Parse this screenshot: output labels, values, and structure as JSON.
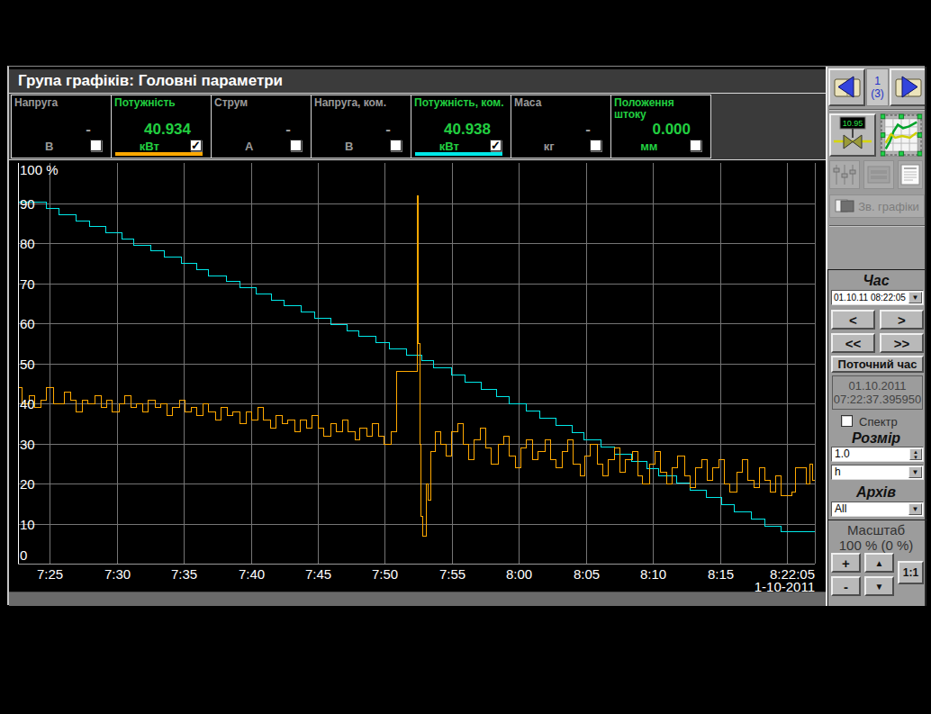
{
  "window": {
    "title": "Група графіків: Головні параметри"
  },
  "params": [
    {
      "name": "Напруга",
      "value": "-",
      "unit": "В",
      "checked": false,
      "active": false,
      "underline": ""
    },
    {
      "name": "Потужність",
      "value": "40.934",
      "unit": "кВт",
      "checked": true,
      "active": true,
      "underline": "#ffa800"
    },
    {
      "name": "Струм",
      "value": "-",
      "unit": "А",
      "checked": false,
      "active": false,
      "underline": ""
    },
    {
      "name": "Напруга, ком.",
      "value": "-",
      "unit": "В",
      "checked": false,
      "active": false,
      "underline": ""
    },
    {
      "name": "Потужність, ком.",
      "value": "40.938",
      "unit": "кВт",
      "checked": true,
      "active": true,
      "underline": "#00e8e8"
    },
    {
      "name": "Маса",
      "value": "-",
      "unit": "кг",
      "checked": false,
      "active": false,
      "underline": ""
    },
    {
      "name": "Положення штоку",
      "value": "0.000",
      "unit": "мм",
      "checked": false,
      "active": true,
      "underline": ""
    }
  ],
  "sidebar": {
    "page_current": "1",
    "page_total": "(3)",
    "valve_display": "10.95",
    "group_button_label": "Зв. графіки",
    "time": {
      "title": "Час",
      "combo_value": "01.10.11 08:22:05",
      "btn_prev": "<",
      "btn_next": ">",
      "btn_prev_fast": "<<",
      "btn_next_fast": ">>",
      "current_time_btn": "Поточний час",
      "info_date": "01.10.2011",
      "info_time": "07:22:37.395950",
      "spectrum_label": "Спектр"
    },
    "size": {
      "title": "Розмір",
      "value": "1.0",
      "unit_value": "h"
    },
    "archive": {
      "title": "Архів",
      "value": "All"
    },
    "scale": {
      "title": "Масштаб",
      "value": "100 % (0 %)",
      "plus": "+",
      "minus": "-",
      "one_to_one": "1:1"
    }
  },
  "chart_data": {
    "type": "line",
    "ylim": [
      0,
      100
    ],
    "xlim_minutes": [
      0,
      59.47
    ],
    "y_top_label": "100 %",
    "y_zero_label": "0",
    "y_ticks": [
      10,
      20,
      30,
      40,
      50,
      60,
      70,
      80,
      90
    ],
    "x_ticks": [
      {
        "t": 2.383,
        "label": "7:25"
      },
      {
        "t": 7.383,
        "label": "7:30"
      },
      {
        "t": 12.383,
        "label": "7:35"
      },
      {
        "t": 17.383,
        "label": "7:40"
      },
      {
        "t": 22.383,
        "label": "7:45"
      },
      {
        "t": 27.383,
        "label": "7:50"
      },
      {
        "t": 32.383,
        "label": "7:55"
      },
      {
        "t": 37.383,
        "label": "8:00"
      },
      {
        "t": 42.383,
        "label": "8:05"
      },
      {
        "t": 47.383,
        "label": "8:10"
      },
      {
        "t": 52.383,
        "label": "8:15"
      },
      {
        "t": 57.383,
        "label": ""
      }
    ],
    "x_end_label": "8:22:05",
    "date_label": "1-10-2011",
    "grid_color": "#757575",
    "series": [
      {
        "name": "Потужність, ком.",
        "color": "#00e8e8",
        "points": [
          [
            0,
            90.3
          ],
          [
            2.1,
            88.8
          ],
          [
            3.0,
            87.3
          ],
          [
            4.3,
            85.7
          ],
          [
            5.3,
            84.2
          ],
          [
            6.55,
            82.7
          ],
          [
            7.7,
            81.2
          ],
          [
            8.6,
            79.6
          ],
          [
            9.9,
            78.1
          ],
          [
            10.9,
            76.6
          ],
          [
            12.15,
            75.1
          ],
          [
            13.3,
            73.5
          ],
          [
            14.2,
            72
          ],
          [
            15.5,
            70.5
          ],
          [
            16.5,
            69
          ],
          [
            17.75,
            67.4
          ],
          [
            18.9,
            65.9
          ],
          [
            19.8,
            64.4
          ],
          [
            21.1,
            62.9
          ],
          [
            22.1,
            61.3
          ],
          [
            23.35,
            59.8
          ],
          [
            24.5,
            58.3
          ],
          [
            25.4,
            56.8
          ],
          [
            26.7,
            55.2
          ],
          [
            27.7,
            53.7
          ],
          [
            28.95,
            52.2
          ],
          [
            30.1,
            50.7
          ],
          [
            31.0,
            48.9
          ],
          [
            32.3,
            47.1
          ],
          [
            33.3,
            45.3
          ],
          [
            34.55,
            43.5
          ],
          [
            35.7,
            41.7
          ],
          [
            36.6,
            39.9
          ],
          [
            37.9,
            38.1
          ],
          [
            38.9,
            36.3
          ],
          [
            40.15,
            34.5
          ],
          [
            41.3,
            32.7
          ],
          [
            42.2,
            31
          ],
          [
            43.5,
            29.2
          ],
          [
            44.5,
            27.4
          ],
          [
            45.75,
            25.6
          ],
          [
            46.9,
            23.8
          ],
          [
            47.8,
            22
          ],
          [
            49.1,
            20.2
          ],
          [
            50.1,
            18.4
          ],
          [
            51.35,
            16.6
          ],
          [
            52.5,
            14.8
          ],
          [
            53.4,
            13
          ],
          [
            54.7,
            11.2
          ],
          [
            55.7,
            9.5
          ],
          [
            56.95,
            8
          ]
        ]
      },
      {
        "name": "Потужність",
        "color": "#ffa800",
        "points": [
          [
            0,
            44
          ],
          [
            0.3,
            40
          ],
          [
            0.8,
            42
          ],
          [
            1.2,
            39
          ],
          [
            1.7,
            41
          ],
          [
            2.1,
            44
          ],
          [
            2.6,
            40
          ],
          [
            3.0,
            40
          ],
          [
            3.4,
            43
          ],
          [
            3.9,
            41
          ],
          [
            4.3,
            38
          ],
          [
            4.8,
            41
          ],
          [
            5.2,
            40
          ],
          [
            5.7,
            42
          ],
          [
            6.2,
            39
          ],
          [
            6.6,
            41
          ],
          [
            7.0,
            38
          ],
          [
            7.5,
            40
          ],
          [
            7.9,
            42
          ],
          [
            8.4,
            39
          ],
          [
            8.8,
            40
          ],
          [
            9.3,
            38
          ],
          [
            9.7,
            41
          ],
          [
            10.2,
            39
          ],
          [
            10.6,
            40
          ],
          [
            11.1,
            37
          ],
          [
            11.5,
            39
          ],
          [
            12.0,
            41
          ],
          [
            12.4,
            38
          ],
          [
            12.9,
            39
          ],
          [
            13.3,
            37
          ],
          [
            13.8,
            40
          ],
          [
            14.2,
            38
          ],
          [
            14.7,
            36
          ],
          [
            15.1,
            39
          ],
          [
            15.6,
            37
          ],
          [
            16.0,
            38
          ],
          [
            16.5,
            35
          ],
          [
            17.0,
            38
          ],
          [
            17.4,
            36
          ],
          [
            17.9,
            39
          ],
          [
            18.3,
            36
          ],
          [
            18.8,
            34
          ],
          [
            19.2,
            37
          ],
          [
            19.7,
            35
          ],
          [
            20.1,
            36
          ],
          [
            20.6,
            33
          ],
          [
            21.0,
            36
          ],
          [
            21.5,
            34
          ],
          [
            21.9,
            37
          ],
          [
            22.4,
            34
          ],
          [
            22.8,
            32
          ],
          [
            23.3,
            35
          ],
          [
            23.7,
            33
          ],
          [
            24.2,
            36
          ],
          [
            24.6,
            33
          ],
          [
            25.1,
            31
          ],
          [
            25.5,
            34
          ],
          [
            26.0,
            32
          ],
          [
            26.4,
            35
          ],
          [
            26.9,
            32
          ],
          [
            27.3,
            30
          ],
          [
            27.8,
            33
          ],
          [
            28.2,
            48
          ],
          [
            29.6,
            48
          ],
          [
            29.75,
            92
          ],
          [
            29.85,
            55
          ],
          [
            29.95,
            30
          ],
          [
            30.05,
            12
          ],
          [
            30.2,
            7
          ],
          [
            30.45,
            20
          ],
          [
            30.6,
            16
          ],
          [
            30.8,
            28
          ],
          [
            31.1,
            33
          ],
          [
            31.5,
            30
          ],
          [
            31.9,
            27
          ],
          [
            32.3,
            33
          ],
          [
            32.8,
            35
          ],
          [
            33.2,
            30
          ],
          [
            33.6,
            26
          ],
          [
            34.0,
            31
          ],
          [
            34.5,
            34
          ],
          [
            34.9,
            29
          ],
          [
            35.3,
            25
          ],
          [
            35.8,
            30
          ],
          [
            36.2,
            32
          ],
          [
            36.6,
            27
          ],
          [
            37.1,
            24
          ],
          [
            37.5,
            29
          ],
          [
            37.9,
            31
          ],
          [
            38.4,
            26
          ],
          [
            38.8,
            28
          ],
          [
            39.3,
            31
          ],
          [
            39.7,
            26
          ],
          [
            40.1,
            24
          ],
          [
            40.6,
            28
          ],
          [
            41.0,
            31
          ],
          [
            41.4,
            25
          ],
          [
            41.9,
            22
          ],
          [
            42.3,
            27
          ],
          [
            42.7,
            30
          ],
          [
            43.2,
            25
          ],
          [
            43.6,
            22
          ],
          [
            44.0,
            26
          ],
          [
            44.5,
            29
          ],
          [
            44.9,
            23
          ],
          [
            45.3,
            26
          ],
          [
            45.8,
            28
          ],
          [
            46.2,
            22
          ],
          [
            46.6,
            20
          ],
          [
            47.1,
            25
          ],
          [
            47.5,
            28
          ],
          [
            47.9,
            23
          ],
          [
            48.4,
            20
          ],
          [
            48.8,
            24
          ],
          [
            49.2,
            27
          ],
          [
            49.7,
            22
          ],
          [
            50.1,
            19
          ],
          [
            50.5,
            24
          ],
          [
            51.0,
            26
          ],
          [
            51.4,
            21
          ],
          [
            51.8,
            24
          ],
          [
            52.3,
            26
          ],
          [
            52.7,
            20
          ],
          [
            53.1,
            18
          ],
          [
            53.6,
            23
          ],
          [
            54.0,
            26
          ],
          [
            54.4,
            21
          ],
          [
            54.9,
            19
          ],
          [
            55.3,
            24
          ],
          [
            55.7,
            21
          ],
          [
            56.1,
            18
          ],
          [
            56.5,
            22
          ],
          [
            56.9,
            17
          ],
          [
            57.3,
            17
          ],
          [
            57.7,
            18
          ],
          [
            58.0,
            24
          ],
          [
            58.4,
            24
          ],
          [
            58.8,
            20
          ],
          [
            59.1,
            25
          ],
          [
            59.3,
            21
          ]
        ]
      }
    ]
  }
}
